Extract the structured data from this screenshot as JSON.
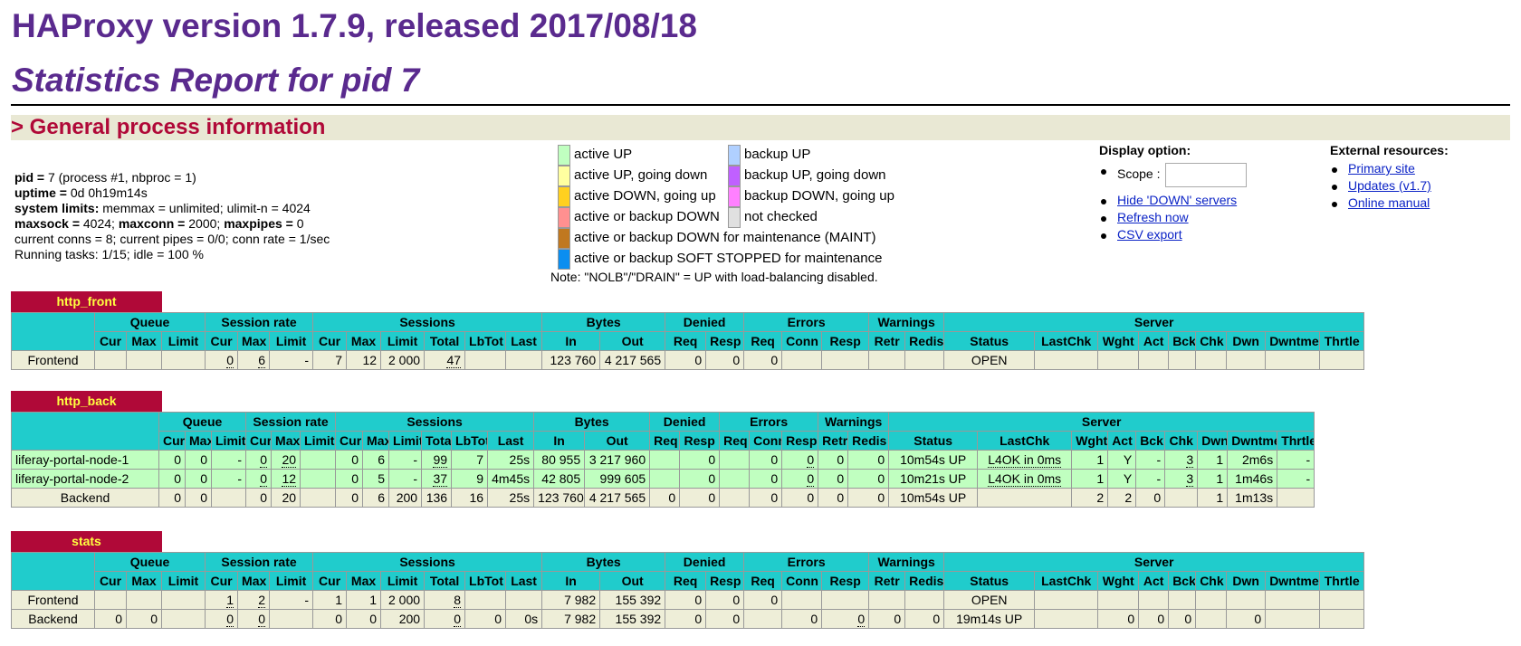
{
  "title": "HAProxy version 1.7.9, released 2017/08/18",
  "subtitle": "Statistics Report for pid 7",
  "section_title": "> General process information",
  "process_info": {
    "pid_label": "pid = ",
    "pid_value": "7 (process #1, nbproc = 1)",
    "uptime_label": "uptime = ",
    "uptime_value": "0d 0h19m14s",
    "limits_label": "system limits:",
    "limits_value": " memmax = unlimited; ulimit-n = 4024",
    "maxsock_label": "maxsock = ",
    "maxsock_value": "4024; ",
    "maxconn_label": "maxconn = ",
    "maxconn_value": "2000; ",
    "maxpipes_label": "maxpipes = ",
    "maxpipes_value": "0",
    "current": "current conns = 8; current pipes = 0/0; conn rate = 1/sec",
    "tasks": "Running tasks: 1/15; idle = 100 %"
  },
  "legend_left": [
    {
      "label": "active UP",
      "color": "#c0ffc0"
    },
    {
      "label": "active UP, going down",
      "color": "#ffffa0"
    },
    {
      "label": "active DOWN, going up",
      "color": "#ffd020"
    },
    {
      "label": "active or backup DOWN",
      "color": "#ff9090"
    },
    {
      "label": "active or backup DOWN for maintenance (MAINT)",
      "color": "#c07820"
    },
    {
      "label": "active or backup SOFT STOPPED for maintenance",
      "color": "#0b8ef0"
    }
  ],
  "legend_right": [
    {
      "label": "backup UP",
      "color": "#b0d0ff"
    },
    {
      "label": "backup UP, going down",
      "color": "#c060ff"
    },
    {
      "label": "backup DOWN, going up",
      "color": "#ff80ff"
    },
    {
      "label": "not checked",
      "color": "#e0e0e0"
    }
  ],
  "note": "Note: \"NOLB\"/\"DRAIN\" = UP with load-balancing disabled.",
  "display": {
    "heading": "Display option:",
    "scope_label": "Scope :",
    "hide_link": "Hide 'DOWN' servers",
    "refresh_link": "Refresh now",
    "csv_link": "CSV export"
  },
  "external": {
    "heading": "External resources:",
    "links": [
      "Primary site",
      "Updates (v1.7)",
      "Online manual"
    ]
  },
  "group_headers": [
    "Queue",
    "Session rate",
    "Sessions",
    "Bytes",
    "Denied",
    "Errors",
    "Warnings",
    "Server"
  ],
  "col_headers": [
    "Cur",
    "Max",
    "Limit",
    "Cur",
    "Max",
    "Limit",
    "Cur",
    "Max",
    "Limit",
    "Total",
    "LbTot",
    "Last",
    "In",
    "Out",
    "Req",
    "Resp",
    "Req",
    "Conn",
    "Resp",
    "Retr",
    "Redis",
    "Status",
    "LastChk",
    "Wght",
    "Act",
    "Bck",
    "Chk",
    "Dwn",
    "Dwntme",
    "Thrtle"
  ],
  "proxies": [
    {
      "name": "http_front",
      "rows": [
        [
          "Frontend",
          "",
          "",
          "",
          "0",
          "6",
          "-",
          "7",
          "12",
          "2 000",
          "47",
          "",
          "",
          "123 760",
          "4 217 565",
          "0",
          "0",
          "0",
          "",
          "",
          "",
          "",
          "OPEN",
          "",
          "",
          "",
          "",
          "",
          "",
          "",
          ""
        ]
      ]
    },
    {
      "name": "http_back",
      "rows": [
        [
          "liferay-portal-node-1",
          "0",
          "0",
          "-",
          "0",
          "20",
          "",
          "0",
          "6",
          "-",
          "99",
          "7",
          "25s",
          "80 955",
          "3 217 960",
          "",
          "0",
          "",
          "0",
          "0",
          "0",
          "0",
          "10m54s UP",
          "L4OK in 0ms",
          "1",
          "Y",
          "-",
          "3",
          "1",
          "2m6s",
          "-"
        ],
        [
          "liferay-portal-node-2",
          "0",
          "0",
          "-",
          "0",
          "12",
          "",
          "0",
          "5",
          "-",
          "37",
          "9",
          "4m45s",
          "42 805",
          "999 605",
          "",
          "0",
          "",
          "0",
          "0",
          "0",
          "0",
          "10m21s UP",
          "L4OK in 0ms",
          "1",
          "Y",
          "-",
          "3",
          "1",
          "1m46s",
          "-"
        ],
        [
          "Backend",
          "0",
          "0",
          "",
          "0",
          "20",
          "",
          "0",
          "6",
          "200",
          "136",
          "16",
          "25s",
          "123 760",
          "4 217 565",
          "0",
          "0",
          "",
          "0",
          "0",
          "0",
          "0",
          "10m54s UP",
          "",
          "2",
          "2",
          "0",
          "",
          "1",
          "1m13s",
          ""
        ]
      ]
    },
    {
      "name": "stats",
      "rows": [
        [
          "Frontend",
          "",
          "",
          "",
          "1",
          "2",
          "-",
          "1",
          "1",
          "2 000",
          "8",
          "",
          "",
          "7 982",
          "155 392",
          "0",
          "0",
          "0",
          "",
          "",
          "",
          "",
          "OPEN",
          "",
          "",
          "",
          "",
          "",
          "",
          "",
          ""
        ],
        [
          "Backend",
          "0",
          "0",
          "",
          "0",
          "0",
          "",
          "0",
          "0",
          "200",
          "0",
          "0",
          "0s",
          "7 982",
          "155 392",
          "0",
          "0",
          "",
          "0",
          "0",
          "0",
          "0",
          "19m14s UP",
          "",
          "0",
          "0",
          "0",
          "",
          "0",
          "",
          ""
        ]
      ]
    }
  ]
}
